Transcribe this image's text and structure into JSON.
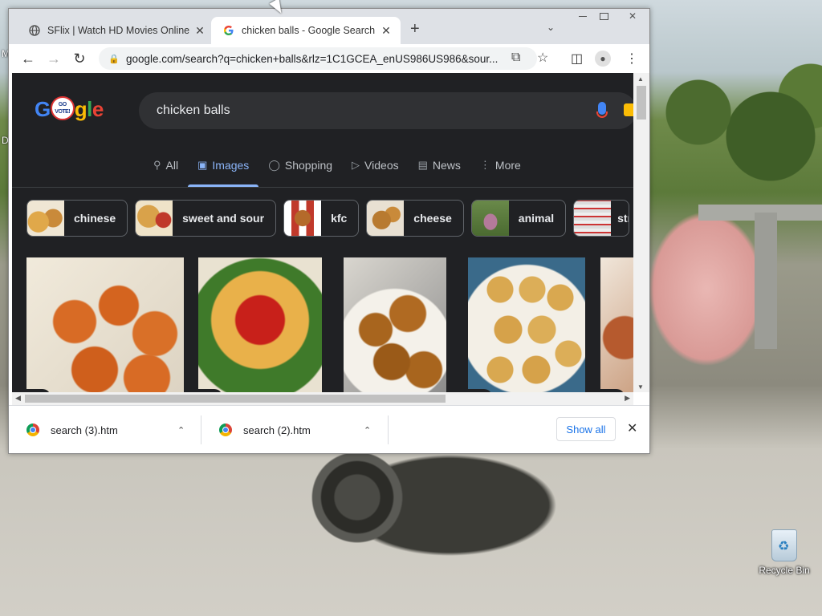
{
  "desktop": {
    "recycle_bin_label": "Recycle Bin",
    "left_edge_labels": [
      "M",
      "D"
    ]
  },
  "browser": {
    "tabs": [
      {
        "title": "SFlix | Watch HD Movies Online F",
        "favicon": "globe-icon",
        "active": false
      },
      {
        "title": "chicken balls - Google Search",
        "favicon": "google-g-icon",
        "active": true
      }
    ],
    "new_tab_label": "+",
    "tab_search_icon": "chevron-down-icon",
    "address": "google.com/search?q=chicken+balls&rlz=1C1GCEA_enUS986US986&sour...",
    "toolbar_icons": [
      "back-icon",
      "forward-icon",
      "reload-icon",
      "lock-icon",
      "share-icon",
      "star-icon",
      "side-panel-icon",
      "profile-icon",
      "menu-icon"
    ]
  },
  "search": {
    "logo_letters": [
      "G",
      "o",
      "o",
      "g",
      "l",
      "e"
    ],
    "badge_text": "GO VOTE!",
    "query": "chicken balls",
    "tabs": [
      {
        "label": "All",
        "icon": "search-icon",
        "active": false
      },
      {
        "label": "Images",
        "icon": "image-icon",
        "active": true
      },
      {
        "label": "Shopping",
        "icon": "tag-icon",
        "active": false
      },
      {
        "label": "Videos",
        "icon": "play-icon",
        "active": false
      },
      {
        "label": "News",
        "icon": "newspaper-icon",
        "active": false
      },
      {
        "label": "More",
        "icon": "kebab-icon",
        "active": false
      }
    ],
    "chips": [
      {
        "label": "chinese",
        "color": "#c98a3a"
      },
      {
        "label": "sweet and sour",
        "color": "#d9a24a"
      },
      {
        "label": "kfc",
        "color": "#c0392b"
      },
      {
        "label": "cheese",
        "color": "#b87a30"
      },
      {
        "label": "animal",
        "color": "#9a5a7a"
      },
      {
        "label": "str",
        "color": "#c9c9c0"
      }
    ],
    "results": [
      {
        "colors": [
          "#f1eadb",
          "#d86b25"
        ],
        "badge": "fork-knife-icon"
      },
      {
        "colors": [
          "#e9e2d1",
          "#c98a3a"
        ],
        "badge": "fork-knife-icon"
      },
      {
        "colors": [
          "#e7e3dc",
          "#a8651e"
        ],
        "badge": ""
      },
      {
        "colors": [
          "#e5e0d4",
          "#d9a850"
        ],
        "badge": "fork-knife-icon"
      },
      {
        "colors": [
          "#f0e6da",
          "#b65a2e"
        ],
        "badge": "fork-knife-icon"
      }
    ]
  },
  "downloads": {
    "items": [
      {
        "name": "search (3).htm"
      },
      {
        "name": "search (2).htm"
      }
    ],
    "show_all_label": "Show all",
    "close_label": "✕"
  },
  "colors": {
    "page_bg": "#202124",
    "accent_blue": "#8ab4f8",
    "link_blue": "#1a73e8"
  }
}
